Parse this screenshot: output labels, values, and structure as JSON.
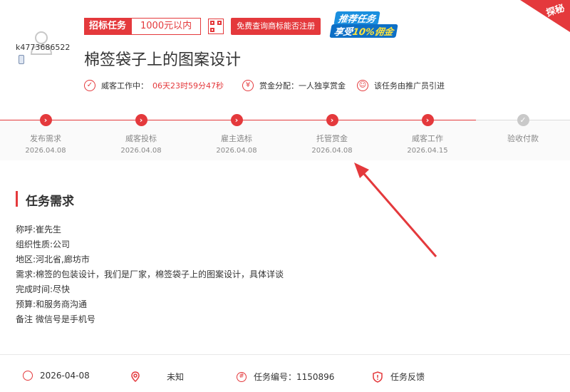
{
  "ribbon": {
    "label": "探秘"
  },
  "user": {
    "name": "k4773686522"
  },
  "tags": {
    "type_label": "招标任务",
    "budget_label": "1000元以内",
    "query_button": "免费查询商标能否注册"
  },
  "promo": {
    "line1": "推荐任务",
    "line2_prefix": "享受",
    "line2_highlight": "10%佣金"
  },
  "task": {
    "title": "棉签袋子上的图案设计"
  },
  "meta": {
    "work_label": "威客工作中：",
    "countdown": "06天23时59分47秒",
    "reward_label": "赏金分配：一人独享赏金",
    "promoter_label": "该任务由推广员引进"
  },
  "steps": [
    {
      "name": "发布需求",
      "date": "2026.04.08"
    },
    {
      "name": "威客投标",
      "date": "2026.04.08"
    },
    {
      "name": "雇主选标",
      "date": "2026.04.08"
    },
    {
      "name": "托管赏金",
      "date": "2026.04.08"
    },
    {
      "name": "威客工作",
      "date": "2026.04.15"
    },
    {
      "name": "验收付款",
      "date": ""
    }
  ],
  "section": {
    "title": "任务需求"
  },
  "requirements": [
    "称呼:崔先生",
    "组织性质:公司",
    "地区:河北省,廊坊市",
    "需求:棉签的包装设计，我们是厂家，棉签袋子上的图案设计，具体详谈",
    "完成时间:尽快",
    "预算:和服务商沟通",
    "备注 微信号是手机号"
  ],
  "footer": {
    "date": "2026-04-08",
    "location": "未知",
    "task_no": "任务编号：1150896",
    "feedback": "任务反馈"
  },
  "colors": {
    "accent": "#e4393c"
  }
}
